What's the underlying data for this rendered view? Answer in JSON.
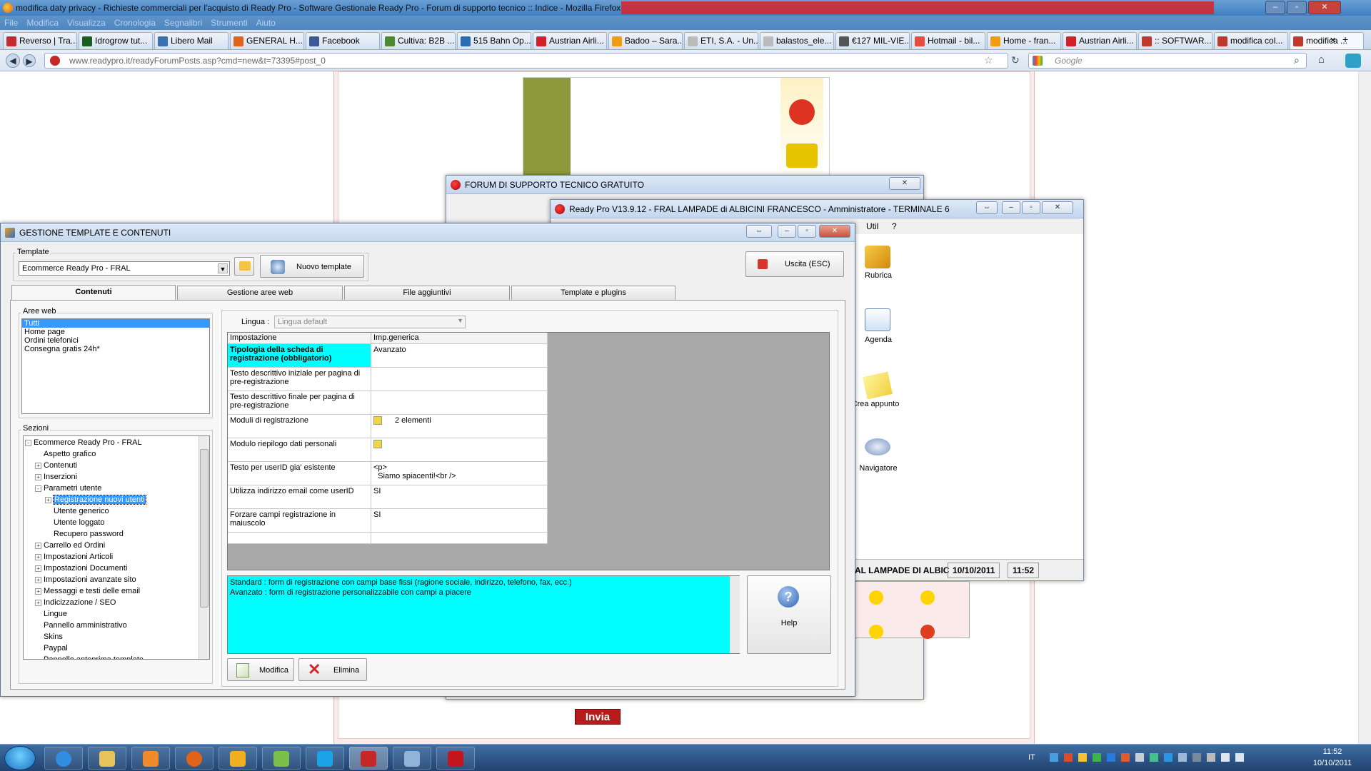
{
  "browser": {
    "title": "modifica daty privacy - Richieste commerciali per l'acquisto di Ready Pro - Software Gestionale Ready Pro - Forum di supporto tecnico :: Indice - Mozilla Firefox",
    "menu": [
      "File",
      "Modifica",
      "Visualizza",
      "Cronologia",
      "Segnalibri",
      "Strumenti",
      "Aiuto"
    ],
    "tabs": [
      {
        "label": "Reverso | Tra...",
        "color": "#c8282f"
      },
      {
        "label": "Idrogrow tut...",
        "color": "#1b5e20"
      },
      {
        "label": "Libero Mail",
        "color": "#3a6fb3"
      },
      {
        "label": "GENERAL H...",
        "color": "#e0631a"
      },
      {
        "label": "Facebook",
        "color": "#3b5998"
      },
      {
        "label": "Cultiva: B2B ...",
        "color": "#4b8a2f"
      },
      {
        "label": "515 Bahn Op...",
        "color": "#2a6bb5"
      },
      {
        "label": "Austrian Airli...",
        "color": "#d32027"
      },
      {
        "label": "Badoo – Sara...",
        "color": "#f39c12"
      },
      {
        "label": "ETI, S.A. - Un...",
        "color": "#bbb"
      },
      {
        "label": "balastos_ele...",
        "color": "#bbb"
      },
      {
        "label": "€127 MIL-VIE...",
        "color": "#555"
      },
      {
        "label": "Hotmail - bil...",
        "color": "#e74c3c"
      },
      {
        "label": "Home - fran...",
        "color": "#f39c12"
      },
      {
        "label": "Austrian Airli...",
        "color": "#d32027"
      },
      {
        "label": ":: SOFTWAR...",
        "color": "#c0392b"
      },
      {
        "label": "modifica col...",
        "color": "#c0392b"
      },
      {
        "label": "modifica ...",
        "color": "#c0392b"
      }
    ],
    "url": "www.readypro.it/readyForumPosts.asp?cmd=new&t=73395#post_0",
    "search_placeholder": "Google"
  },
  "forum_window": {
    "title": "FORUM DI SUPPORTO TECNICO GRATUITO",
    "send_label": "Invia"
  },
  "readypro_window": {
    "title": "Ready Pro V13.9.12 - FRAL LAMPADE di ALBICINI FRANCESCO - Amministratore - TERMINALE 6",
    "menu": [
      "Util",
      "?"
    ],
    "icons": [
      {
        "label": "Rubrica",
        "icon": "book-icon"
      },
      {
        "label": "Agenda",
        "icon": "calendar-icon"
      },
      {
        "label": "Crea appunto",
        "icon": "note-icon"
      },
      {
        "label": "Navigatore",
        "icon": "navigator-icon"
      }
    ],
    "status": {
      "company": "AL LAMPADE DI ALBIC",
      "date": "10/10/2011",
      "time": "11:52"
    }
  },
  "gestione": {
    "title": "GESTIONE TEMPLATE E CONTENUTI",
    "template_group": "Template",
    "template_value": "Ecommerce Ready Pro - FRAL",
    "new_template": "Nuovo template",
    "exit": "Uscita (ESC)",
    "tabs": [
      "Contenuti",
      "Gestione aree web",
      "File aggiuntivi",
      "Template e plugins"
    ],
    "aree_web_label": "Aree web",
    "aree_web": [
      "Tutti",
      "Home page",
      "Ordini telefonici",
      "Consegna gratis 24h*"
    ],
    "sezioni_label": "Sezioni",
    "tree": [
      {
        "label": "Ecommerce Ready Pro - FRAL",
        "level": 0,
        "exp": "-"
      },
      {
        "label": "Aspetto grafico",
        "level": 1,
        "exp": ""
      },
      {
        "label": "Contenuti",
        "level": 1,
        "exp": "+"
      },
      {
        "label": "Inserzioni",
        "level": 1,
        "exp": "+"
      },
      {
        "label": "Parametri utente",
        "level": 1,
        "exp": "-"
      },
      {
        "label": "Registrazione nuovi utenti",
        "level": 2,
        "exp": "+",
        "selected": true
      },
      {
        "label": "Utente generico",
        "level": 2,
        "exp": ""
      },
      {
        "label": "Utente loggato",
        "level": 2,
        "exp": ""
      },
      {
        "label": "Recupero password",
        "level": 2,
        "exp": ""
      },
      {
        "label": "Carrello ed Ordini",
        "level": 1,
        "exp": "+"
      },
      {
        "label": "Impostazioni Articoli",
        "level": 1,
        "exp": "+"
      },
      {
        "label": "Impostazioni Documenti",
        "level": 1,
        "exp": "+"
      },
      {
        "label": "Impostazioni avanzate sito",
        "level": 1,
        "exp": "+"
      },
      {
        "label": "Messaggi e testi delle email",
        "level": 1,
        "exp": "+"
      },
      {
        "label": "Indicizzazione / SEO",
        "level": 1,
        "exp": "+"
      },
      {
        "label": "Lingue",
        "level": 1,
        "exp": ""
      },
      {
        "label": "Pannello amministrativo",
        "level": 1,
        "exp": ""
      },
      {
        "label": "Skins",
        "level": 1,
        "exp": ""
      },
      {
        "label": "Paypal",
        "level": 1,
        "exp": ""
      },
      {
        "label": "Pannello anteprima template",
        "level": 1,
        "exp": ""
      }
    ],
    "lingua_label": "Lingua :",
    "lingua_value": "Lingua default",
    "grid_headers": [
      "Impostazione",
      "Imp.generica"
    ],
    "grid_rows": [
      {
        "name": "Tipologia della scheda di registrazione (obbligatorio)",
        "value": "Avanzato",
        "highlight": true
      },
      {
        "name": "Testo descrittivo iniziale per pagina di pre-registrazione",
        "value": ""
      },
      {
        "name": "Testo descrittivo finale per pagina di pre-registrazione",
        "value": ""
      },
      {
        "name": "Moduli di registrazione",
        "value": "2 elementi",
        "icon": true
      },
      {
        "name": "Modulo riepilogo dati personali",
        "value": "",
        "icon": true
      },
      {
        "name": "Testo per userID gia' esistente",
        "value": "<p>\n  Siamo spiacenti!<br />"
      },
      {
        "name": "Utilizza indirizzo email come userID",
        "value": "SI"
      },
      {
        "name": "Forzare campi registrazione in maiuscolo",
        "value": "SI"
      }
    ],
    "description": [
      "Standard : form di registrazione con campi base fissi (ragione sociale, indirizzo, telefono, fax, ecc.)",
      "Avanzato : form di registrazione personalizzabile con campi a piacere"
    ],
    "help": "Help",
    "modifica": "Modifica",
    "elimina": "Elimina"
  },
  "taskbar": {
    "apps": [
      "internet-explorer",
      "explorer",
      "media-player",
      "firefox",
      "outlook",
      "network",
      "skype",
      "readypro",
      "paint",
      "acrobat"
    ],
    "lang": "IT",
    "time": "11:52",
    "date": "10/10/2011"
  }
}
